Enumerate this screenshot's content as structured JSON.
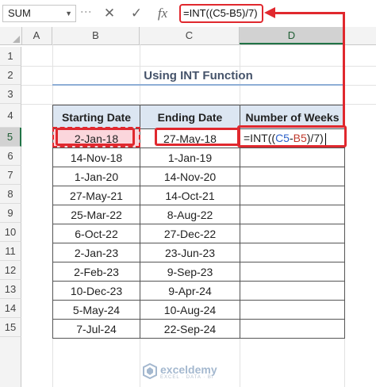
{
  "formula_bar": {
    "name_box": "SUM",
    "cancel_icon": "✕",
    "enter_icon": "✓",
    "fx_icon": "fx",
    "formula": "=INT((C5-B5)/7)"
  },
  "columns": [
    "A",
    "B",
    "C",
    "D"
  ],
  "rows": [
    "1",
    "2",
    "3",
    "4",
    "5",
    "6",
    "7",
    "8",
    "9",
    "10",
    "11",
    "12",
    "13",
    "14",
    "15"
  ],
  "selected_cell": "D5",
  "title": "Using INT Function",
  "table": {
    "headers": [
      "Starting Date",
      "Ending Date",
      "Number of Weeks"
    ],
    "rows": [
      {
        "start": "2-Jan-18",
        "end": "27-May-18",
        "weeks_formula_prefix": "=INT((",
        "ref_c": "C5",
        "minus": "-",
        "ref_b": "B5",
        "suffix": ")/7)"
      },
      {
        "start": "14-Nov-18",
        "end": "1-Jan-19",
        "weeks": ""
      },
      {
        "start": "1-Jan-20",
        "end": "14-Nov-20",
        "weeks": ""
      },
      {
        "start": "27-May-21",
        "end": "14-Oct-21",
        "weeks": ""
      },
      {
        "start": "25-Mar-22",
        "end": "8-Aug-22",
        "weeks": ""
      },
      {
        "start": "6-Oct-22",
        "end": "27-Dec-22",
        "weeks": ""
      },
      {
        "start": "2-Jan-23",
        "end": "23-Jun-23",
        "weeks": ""
      },
      {
        "start": "2-Feb-23",
        "end": "9-Sep-23",
        "weeks": ""
      },
      {
        "start": "10-Dec-23",
        "end": "9-Apr-24",
        "weeks": ""
      },
      {
        "start": "5-May-24",
        "end": "10-Aug-24",
        "weeks": ""
      },
      {
        "start": "7-Jul-24",
        "end": "22-Sep-24",
        "weeks": ""
      }
    ]
  },
  "watermark": {
    "name": "exceldemy",
    "tagline": "EXCEL · DATA · BI"
  },
  "colors": {
    "accent": "#e0282e",
    "header_fill": "#dce6f2",
    "excel_green": "#217346",
    "ref_blue": "#2d61c9",
    "ref_red": "#c0392b"
  }
}
